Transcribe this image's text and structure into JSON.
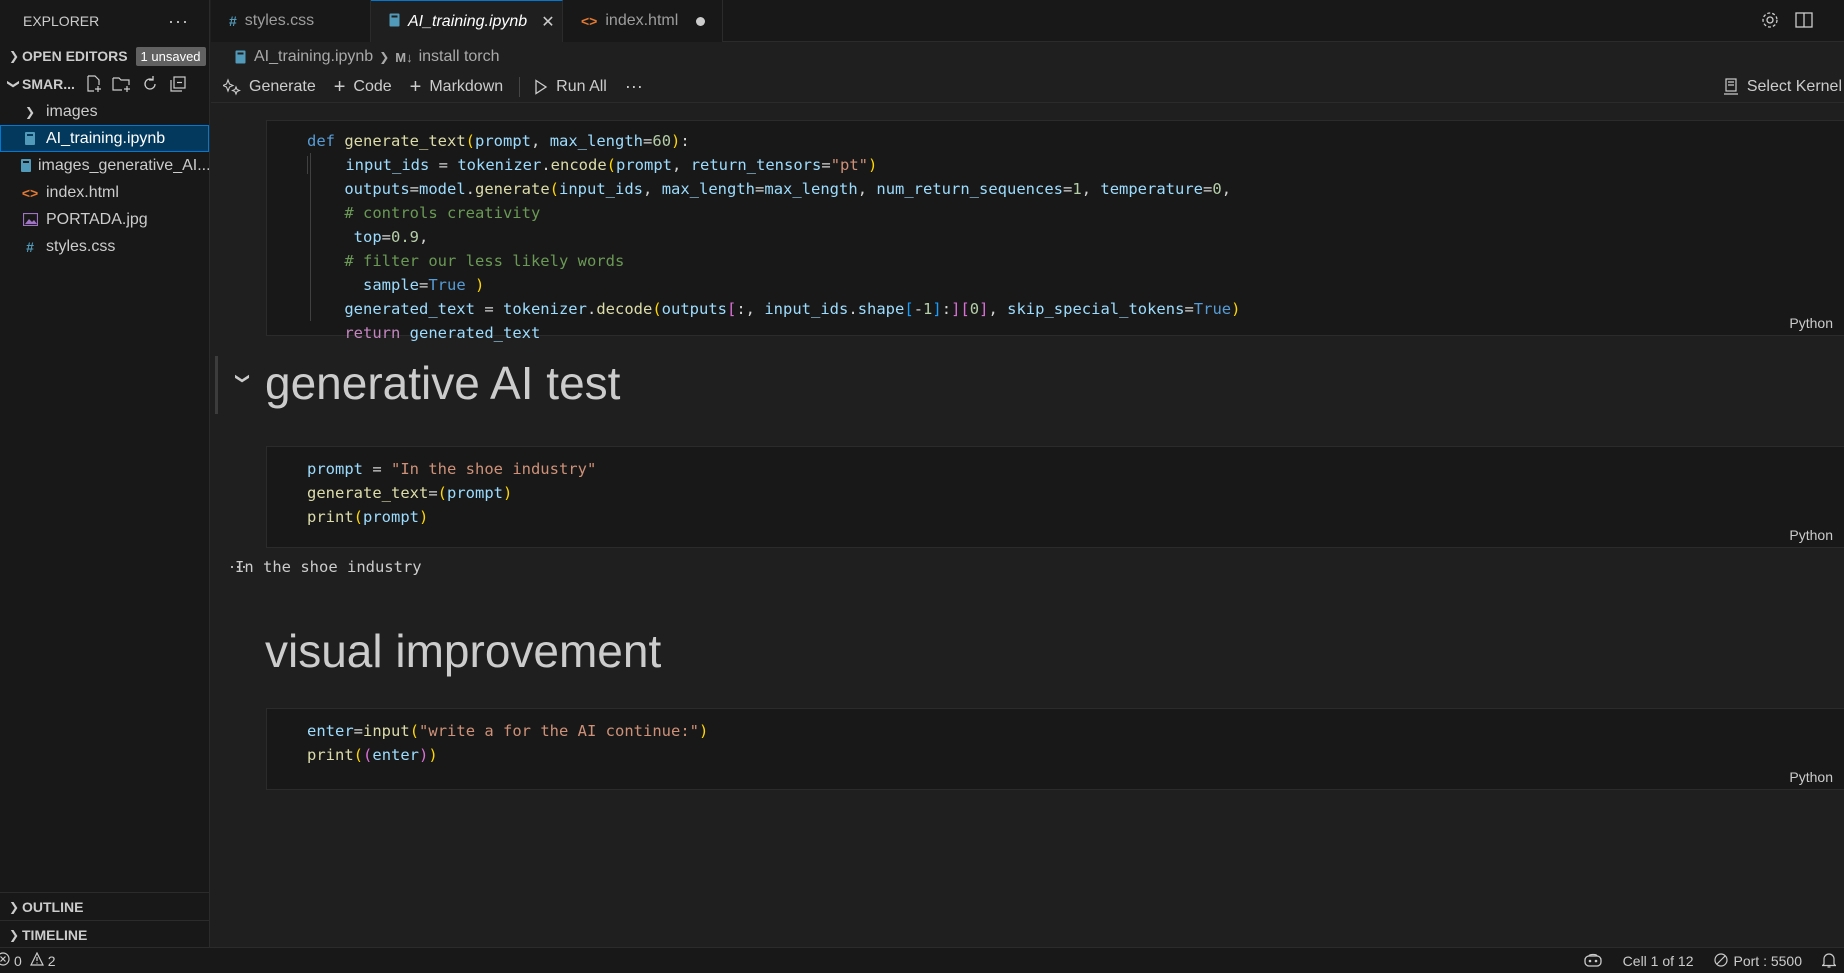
{
  "explorer": {
    "title": "EXPLORER",
    "more": "···",
    "open_editors": "OPEN EDITORS",
    "unsaved_badge": "1 unsaved",
    "folder": "SMAR...",
    "files": [
      {
        "name": "images",
        "type": "folder"
      },
      {
        "name": "AI_training.ipynb",
        "type": "notebook"
      },
      {
        "name": "images_generative_AI...",
        "type": "notebook"
      },
      {
        "name": "index.html",
        "type": "html"
      },
      {
        "name": "PORTADA.jpg",
        "type": "image"
      },
      {
        "name": "styles.css",
        "type": "css"
      }
    ],
    "outline": "OUTLINE",
    "timeline": "TIMELINE"
  },
  "tabs": [
    {
      "label": "styles.css",
      "icon": "#"
    },
    {
      "label": "AI_training.ipynb",
      "icon": "notebook"
    },
    {
      "label": "index.html",
      "icon": "<>"
    }
  ],
  "breadcrumb": {
    "file": "AI_training.ipynb",
    "md_icon": "M↓",
    "section": "install torch"
  },
  "toolbar": {
    "generate": "Generate",
    "code": "Code",
    "markdown": "Markdown",
    "run_all": "Run All",
    "more": "···",
    "select_kernel": "Select Kernel"
  },
  "cells": {
    "lang": "Python",
    "heading1": "generative AI test",
    "output1": "In the shoe industry",
    "heading2": "visual improvement",
    "collapsed_output": "···"
  },
  "status": {
    "errors": "0",
    "warnings": "2",
    "cell_position": "Cell 1 of 12",
    "port": "Port : 5500"
  },
  "colors": {
    "accent": "#0078d4",
    "selection": "#04395e",
    "background": "#1f1f1f",
    "sidebar": "#181818"
  }
}
